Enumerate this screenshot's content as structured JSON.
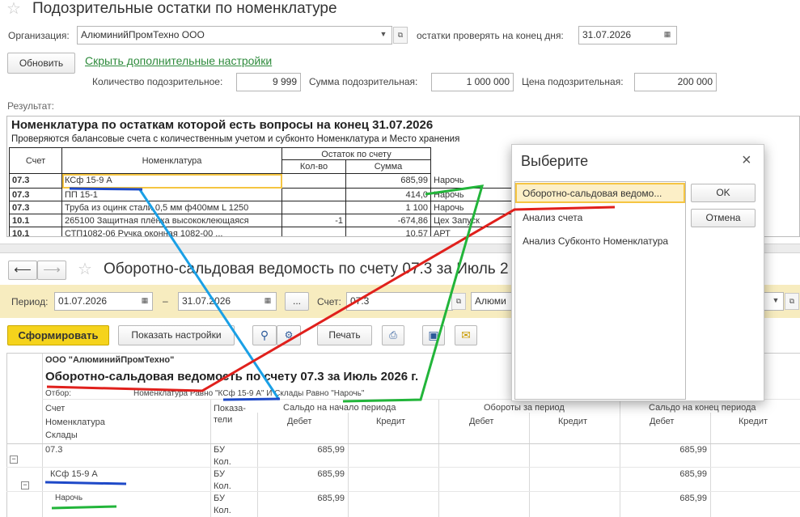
{
  "top": {
    "title": "Подозрительные остатки по номенклатуре",
    "org_label": "Организация:",
    "org_value": "АлюминийПромТехно ООО",
    "date_label": "остатки проверять на конец дня:",
    "date_value": "31.07.2026",
    "refresh_button": "Обновить",
    "hide_link": "Скрыть дополнительные настройки",
    "qty_label": "Количество подозрительное:",
    "qty_value": "9 999",
    "sum_label": "Сумма подозрительная:",
    "sum_value": "1 000 000",
    "price_label": "Цена подозрительная:",
    "price_value": "200 000",
    "result_label": "Результат:"
  },
  "report": {
    "heading": "Номенклатура по остаткам которой есть вопросы на конец 31.07.2026",
    "subheading": "Проверяются балансовые счета с количественным учетом и субконто Номенклатура и Место хранения",
    "headers": {
      "account": "Счет",
      "item": "Номенклатура",
      "balance": "Остаток по счету",
      "qty": "Кол-во",
      "sum": "Сумма"
    },
    "rows": [
      {
        "account": "07.3",
        "item": "КСф 15-9 А",
        "qty": "",
        "sum": "685,99",
        "place": "Нарочь"
      },
      {
        "account": "07.3",
        "item": "ПП 15-1",
        "qty": "",
        "sum": "414,0",
        "place": "Нарочь"
      },
      {
        "account": "07.3",
        "item": "Труба из оцинк стали 0,5 мм ф400мм L 1250",
        "qty": "",
        "sum": "1 100",
        "place": "Нарочь"
      },
      {
        "account": "10.1",
        "item": "265100 Защитная плёнка высококлеющаяся",
        "qty": "-1",
        "sum": "-674,86",
        "place": "Цех Запуск"
      },
      {
        "account": "10.1",
        "item": "СТП1082-06 Ручка оконная 1082-00 ...",
        "qty": "",
        "sum": "10,57",
        "place": "АРТ"
      }
    ]
  },
  "bottom": {
    "title": "Оборотно-сальдовая ведомость по счету 07.3 за Июль 2",
    "period_label": "Период:",
    "date_from": "01.07.2026",
    "dash": "–",
    "date_to": "31.07.2026",
    "dots": "...",
    "account_label": "Счет:",
    "account_value": "07.3",
    "org_value": "Алюми",
    "form_button": "Сформировать",
    "settings_button": "Показать настройки",
    "print_button": "Печать",
    "org_header": "ООО \"АлюминийПромТехно\"",
    "report_title": "Оборотно-сальдовая ведомость по счету 07.3 за Июль 2026 г.",
    "filter_label": "Отбор:",
    "filter_value": "Номенклатура Равно \"КСф 15-9 А\" И Склады Равно \"Нарочь\"",
    "col_account": "Счет",
    "col_item": "Номенклатура",
    "col_store": "Склады",
    "col_indicators": "Показа-тели",
    "col_opening": "Сальдо на начало периода",
    "col_turnover": "Обороты за период",
    "col_closing": "Сальдо на конец периода",
    "debit": "Дебет",
    "credit": "Кредит",
    "rows": [
      {
        "name": "07.3",
        "ind1": "БУ",
        "ind2": "Кол.",
        "open_debit": "685,99",
        "close_debit": "685,99"
      },
      {
        "name": "КСф 15-9 А",
        "ind1": "БУ",
        "ind2": "Кол.",
        "open_debit": "685,99",
        "close_debit": "685,99"
      },
      {
        "name": "Нарочь",
        "ind1": "БУ",
        "ind2": "Кол.",
        "open_debit": "685,99",
        "close_debit": "685,99"
      }
    ]
  },
  "dialog": {
    "title": "Выберите",
    "close": "×",
    "options": [
      "Оборотно-сальдовая ведомо...",
      "Анализ счета",
      "Анализ Субконто Номенклатура"
    ],
    "ok": "OK",
    "cancel": "Отмена"
  },
  "colors": {
    "accent_yellow": "#f7d84a",
    "selection": "#f5c542",
    "link_green": "#2e8b3c",
    "annotation_red": "#e0201c",
    "annotation_blue": "#1e49c8",
    "annotation_cyan": "#1aa0e6",
    "annotation_green": "#22b53a"
  }
}
